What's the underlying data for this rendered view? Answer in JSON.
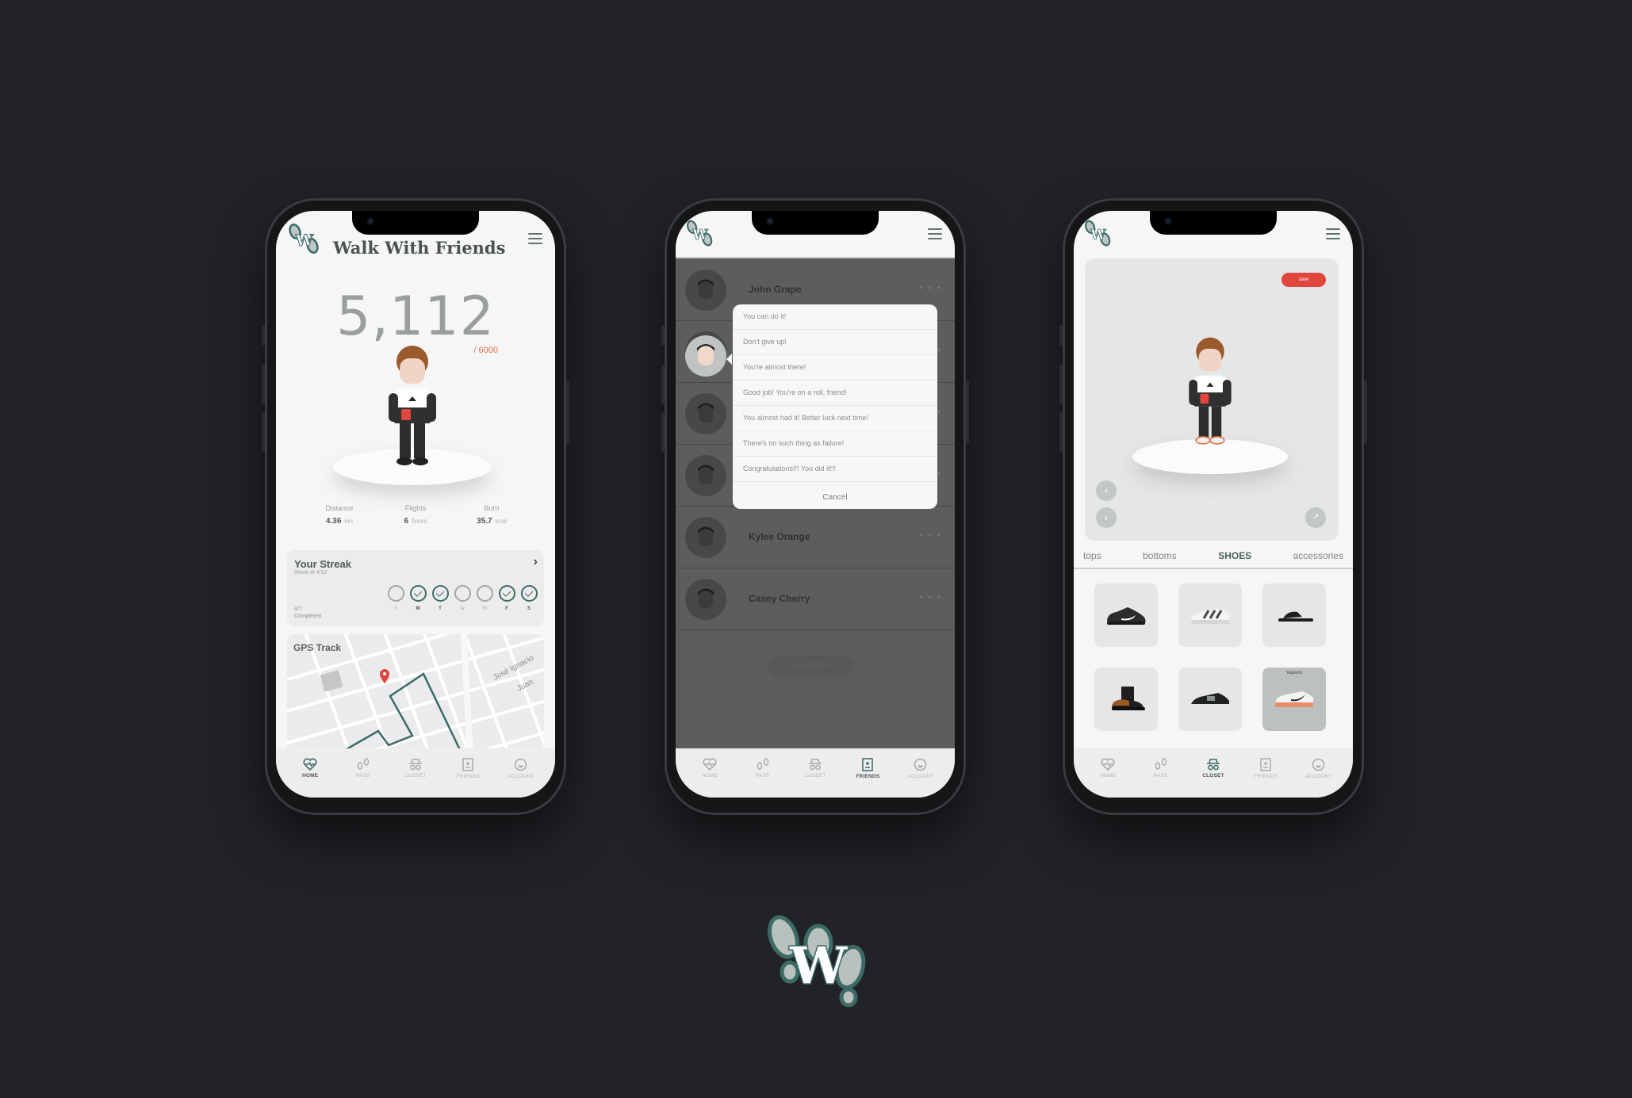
{
  "colors": {
    "background": "#222327",
    "accent_teal": "#3c6b66",
    "accent_red": "#e0453e",
    "goal_orange": "#e0694f"
  },
  "brand": {
    "logo_letter": "W",
    "logo_icon": "footprints-w-logo"
  },
  "tabbar": [
    {
      "label": "HOME",
      "icon": "heart-pulse-icon"
    },
    {
      "label": "PASS",
      "icon": "footprints-icon"
    },
    {
      "label": "CLOSET",
      "icon": "hat-glasses-icon"
    },
    {
      "label": "FRIENDS",
      "icon": "contact-book-icon"
    },
    {
      "label": "ACCOUNT",
      "icon": "face-icon"
    }
  ],
  "home": {
    "title": "Walk With Friends",
    "steps": "5,112",
    "goal": "/ 6000",
    "stats": [
      {
        "label": "Distance",
        "value": "4.36",
        "unit": "km"
      },
      {
        "label": "Flights",
        "value": "6",
        "unit": "floors"
      },
      {
        "label": "Burn",
        "value": "35.7",
        "unit": "kcal"
      }
    ],
    "streak": {
      "title": "Your Streak",
      "subtitle": "Week of 4/12",
      "completed_count": "4/7",
      "completed_label": "Completed",
      "days": [
        {
          "label": "S",
          "done": false
        },
        {
          "label": "M",
          "done": true
        },
        {
          "label": "T",
          "done": true
        },
        {
          "label": "W",
          "done": false
        },
        {
          "label": "Th",
          "done": false
        },
        {
          "label": "F",
          "done": true
        },
        {
          "label": "S",
          "done": true
        }
      ]
    },
    "gps": {
      "title": "GPS Track",
      "streets": [
        "José Ignacio",
        "Juan"
      ]
    },
    "active_tab": "HOME"
  },
  "friends": {
    "list": [
      {
        "name": "John Grape"
      },
      {
        "name": ""
      },
      {
        "name": ""
      },
      {
        "name": ""
      },
      {
        "name": "Kylee Orange"
      },
      {
        "name": "Casey Cherry"
      }
    ],
    "more_label": "• • •",
    "add_friends": "ADD FRIENDS",
    "cheer_popup": {
      "options": [
        "You can do it!",
        "Don't give up!",
        "You're almost there!",
        "Good job! You're on a roll, friend!",
        "You almost had it! Better luck next time!",
        "There's no such thing as failure!",
        "Congratulations!!! You did it!!!"
      ],
      "cancel": "Cancel"
    },
    "active_tab": "FRIENDS"
  },
  "closet": {
    "save": "save",
    "categories": [
      "tops",
      "bottoms",
      "SHOES",
      "accessories"
    ],
    "active_category": "SHOES",
    "shoes": [
      {
        "name": "",
        "type": "black-sneaker"
      },
      {
        "name": "",
        "type": "white-striped-sneaker"
      },
      {
        "name": "",
        "type": "black-slide"
      },
      {
        "name": "",
        "type": "patterned-boot"
      },
      {
        "name": "",
        "type": "black-runner"
      },
      {
        "name": "Vapors",
        "type": "white-orange-sneaker",
        "selected": true
      }
    ],
    "active_tab": "CLOSET"
  }
}
